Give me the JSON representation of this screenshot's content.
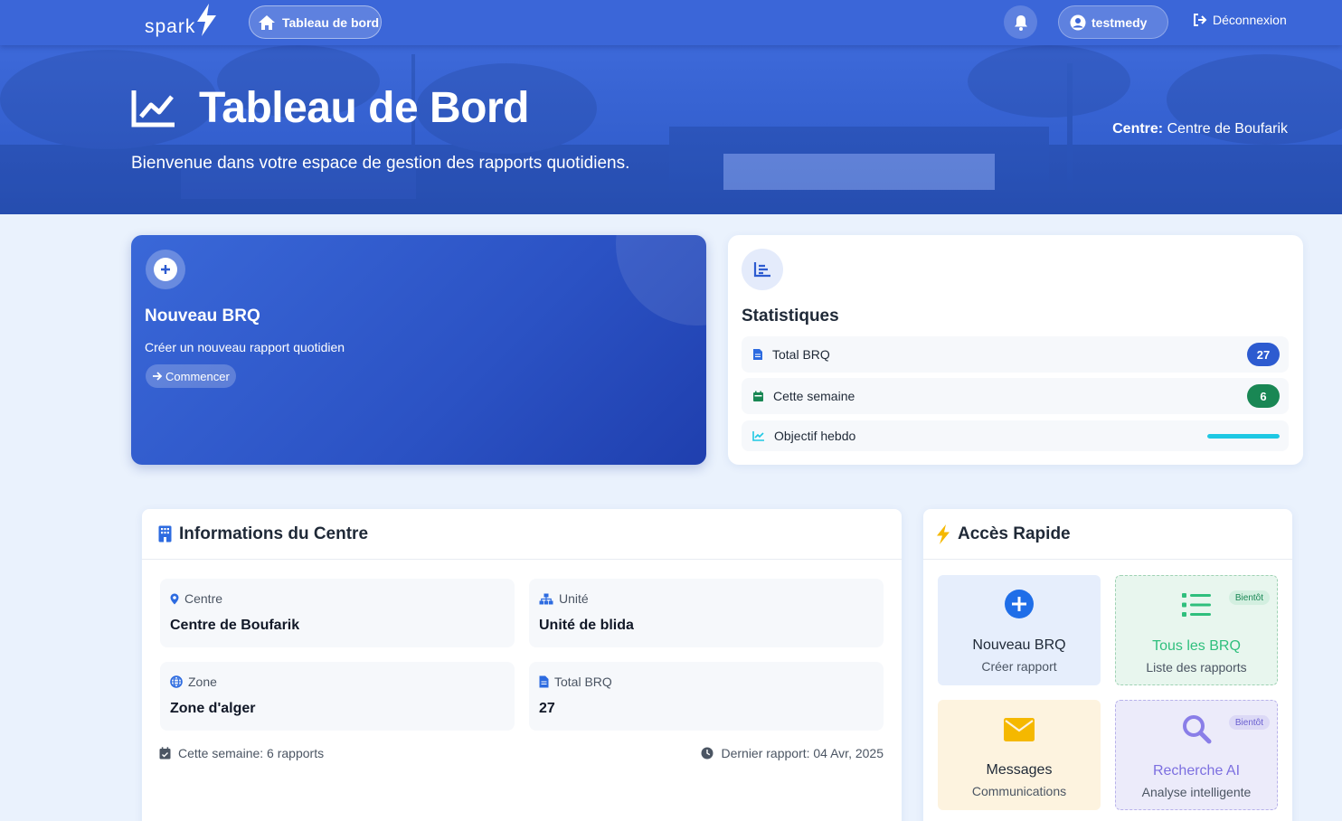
{
  "nav": {
    "logo_text": "spark",
    "home_label": "Tableau de bord",
    "username": "testmedy",
    "logout_label": "Déconnexion"
  },
  "hero": {
    "title": "Tableau de Bord",
    "subtitle": "Bienvenue dans votre espace de gestion des rapports quotidiens.",
    "centre_label": "Centre:",
    "centre_value": "Centre de Boufarik"
  },
  "new_brq": {
    "title": "Nouveau BRQ",
    "description": "Créer un nouveau rapport quotidien",
    "button": "Commencer"
  },
  "stats": {
    "title": "Statistiques",
    "rows": [
      {
        "label": "Total BRQ",
        "value": "27",
        "color": "#2d5bd0",
        "icon": "file-icon"
      },
      {
        "label": "Cette semaine",
        "value": "6",
        "color": "#198754",
        "icon": "calendar-icon"
      },
      {
        "label": "Objectif hebdo",
        "progress": 1.0,
        "color": "#1ec8e3",
        "icon": "chart-line-icon"
      }
    ]
  },
  "info": {
    "title": "Informations du Centre",
    "fields": [
      {
        "label": "Centre",
        "value": "Centre de Boufarik",
        "icon": "map-pin-icon"
      },
      {
        "label": "Unité",
        "value": "Unité de blida",
        "icon": "sitemap-icon"
      },
      {
        "label": "Zone",
        "value": "Zone d'alger",
        "icon": "globe-icon"
      },
      {
        "label": "Total BRQ",
        "value": "27",
        "icon": "file-icon"
      }
    ],
    "week_text": "Cette semaine: 6 rapports",
    "last_report_text": "Dernier rapport: 04 Avr, 2025"
  },
  "quick": {
    "title": "Accès Rapide",
    "tiles": [
      {
        "title": "Nouveau BRQ",
        "subtitle": "Créer rapport",
        "badge": "",
        "icon": "plus-circle-icon"
      },
      {
        "title": "Tous les BRQ",
        "subtitle": "Liste des rapports",
        "badge": "Bientôt",
        "icon": "list-icon"
      },
      {
        "title": "Messages",
        "subtitle": "Communications",
        "badge": "",
        "icon": "envelope-icon"
      },
      {
        "title": "Recherche AI",
        "subtitle": "Analyse intelligente",
        "badge": "Bientôt",
        "icon": "search-icon"
      }
    ]
  },
  "colors": {
    "primary": "#3b66d8",
    "success": "#198754",
    "info": "#1ec8e3",
    "warning": "#f5b800",
    "purple": "#7c6fe0"
  }
}
